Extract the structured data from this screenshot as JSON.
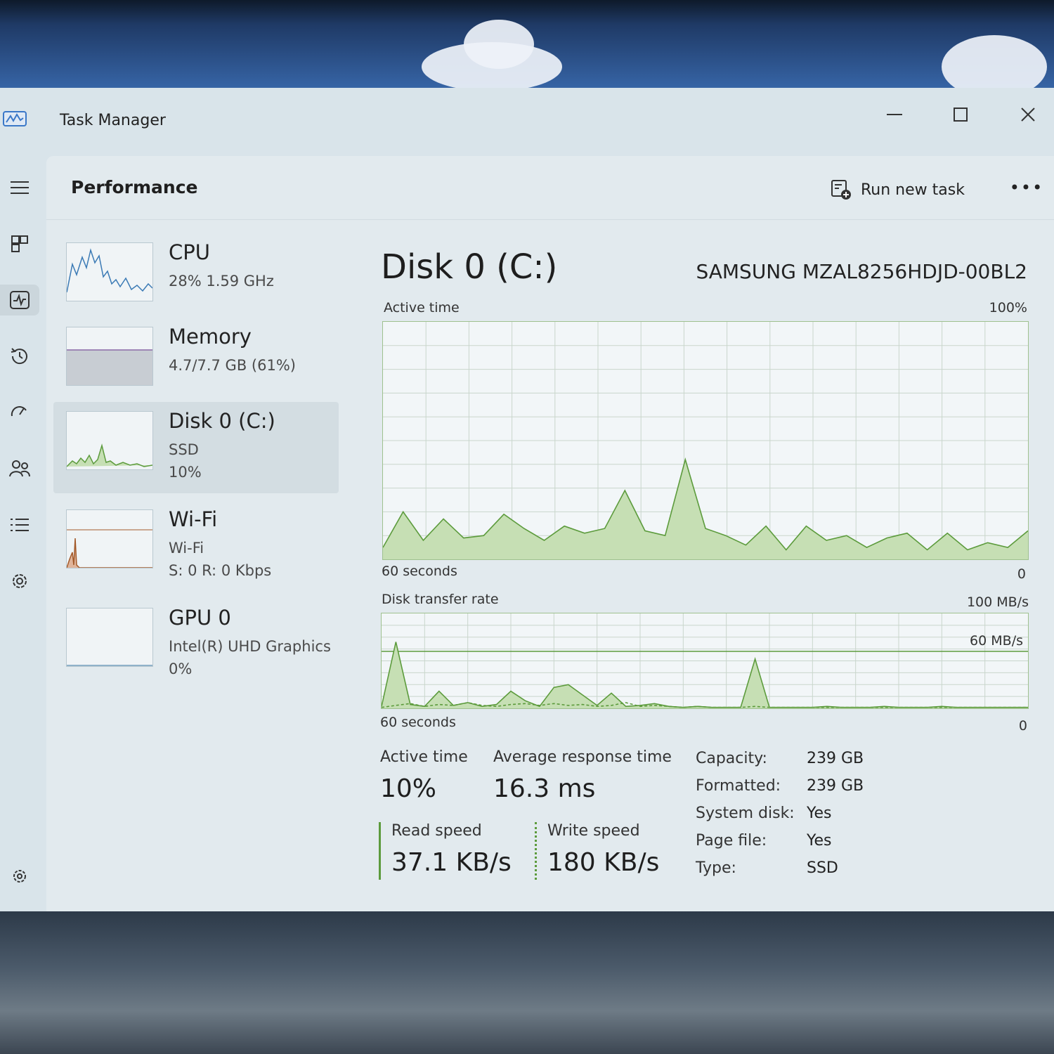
{
  "window": {
    "title": "Task Manager",
    "minimize_glyph": "—",
    "maximize_glyph": "☐",
    "close_glyph": "✕"
  },
  "header": {
    "page_title": "Performance",
    "run_new_task": "Run new task",
    "more": "•••"
  },
  "nav": {
    "items": [
      {
        "icon": "hamburger-menu-icon"
      },
      {
        "icon": "processes-icon"
      },
      {
        "icon": "performance-icon",
        "active": true
      },
      {
        "icon": "app-history-icon"
      },
      {
        "icon": "startup-apps-icon"
      },
      {
        "icon": "users-icon"
      },
      {
        "icon": "details-icon"
      },
      {
        "icon": "services-icon"
      },
      {
        "icon": "settings-icon"
      }
    ]
  },
  "devices": [
    {
      "name": "CPU",
      "lines": [
        "28%  1.59 GHz"
      ],
      "color": "#3b7ab5"
    },
    {
      "name": "Memory",
      "lines": [
        "4.7/7.7 GB (61%)"
      ],
      "color": "#8a6aa8"
    },
    {
      "name": "Disk 0 (C:)",
      "lines": [
        "SSD",
        "10%"
      ],
      "color": "#5c9b3c",
      "selected": true
    },
    {
      "name": "Wi-Fi",
      "lines": [
        "Wi-Fi",
        "S: 0 R: 0 Kbps"
      ],
      "color": "#a35a2a"
    },
    {
      "name": "GPU 0",
      "lines": [
        "Intel(R) UHD Graphics",
        "0%"
      ],
      "color": "#2f6f9f"
    }
  ],
  "detail": {
    "title": "Disk 0 (C:)",
    "model": "SAMSUNG MZAL8256HDJD-00BL2",
    "active_time_graph": {
      "label": "Active time",
      "max_label": "100%",
      "time_label": "60 seconds",
      "min_label": "0",
      "values": [
        5,
        20,
        8,
        17,
        9,
        10,
        19,
        13,
        8,
        14,
        11,
        13,
        29,
        12,
        10,
        42,
        13,
        10,
        6,
        14,
        4,
        14,
        8,
        10,
        5,
        9,
        11,
        4,
        11,
        4,
        7,
        5,
        12
      ]
    },
    "transfer_graph": {
      "label": "Disk transfer rate",
      "max_label": "100 MB/s",
      "ref_label": "60 MB/s",
      "ref_value": 60,
      "time_label": "60 seconds",
      "min_label": "0",
      "read_values": [
        2,
        70,
        4,
        2,
        18,
        3,
        6,
        2,
        4,
        18,
        8,
        2,
        22,
        25,
        14,
        3,
        16,
        2,
        3,
        5,
        2,
        1,
        2,
        1,
        1,
        1,
        52,
        1,
        1,
        1,
        1,
        2,
        1,
        1,
        1,
        2,
        1,
        1,
        1,
        2,
        1,
        1,
        1,
        1,
        1,
        1
      ],
      "write_values": [
        1,
        3,
        5,
        2,
        4,
        3,
        6,
        3,
        2,
        4,
        5,
        3,
        5,
        3,
        4,
        2,
        3,
        6,
        2,
        3,
        2,
        1,
        2,
        1,
        1,
        1,
        2,
        1,
        1,
        1,
        1,
        1,
        1,
        1,
        1,
        1,
        1,
        1,
        1,
        1,
        1,
        1,
        1,
        1,
        1,
        1
      ]
    },
    "stats": {
      "active_time_label": "Active time",
      "active_time_value": "10%",
      "avg_response_label": "Average response time",
      "avg_response_value": "16.3 ms",
      "read_label": "Read speed",
      "read_value": "37.1 KB/s",
      "write_label": "Write speed",
      "write_value": "180 KB/s"
    },
    "info": [
      {
        "key": "Capacity:",
        "value": "239 GB"
      },
      {
        "key": "Formatted:",
        "value": "239 GB"
      },
      {
        "key": "System disk:",
        "value": "Yes"
      },
      {
        "key": "Page file:",
        "value": "Yes"
      },
      {
        "key": "Type:",
        "value": "SSD"
      }
    ]
  },
  "colors": {
    "disk_green": "#5c9b3c",
    "disk_fill": "#c6dfb4",
    "graph_border": "#9fc18f",
    "grid": "#c9d6cc"
  }
}
